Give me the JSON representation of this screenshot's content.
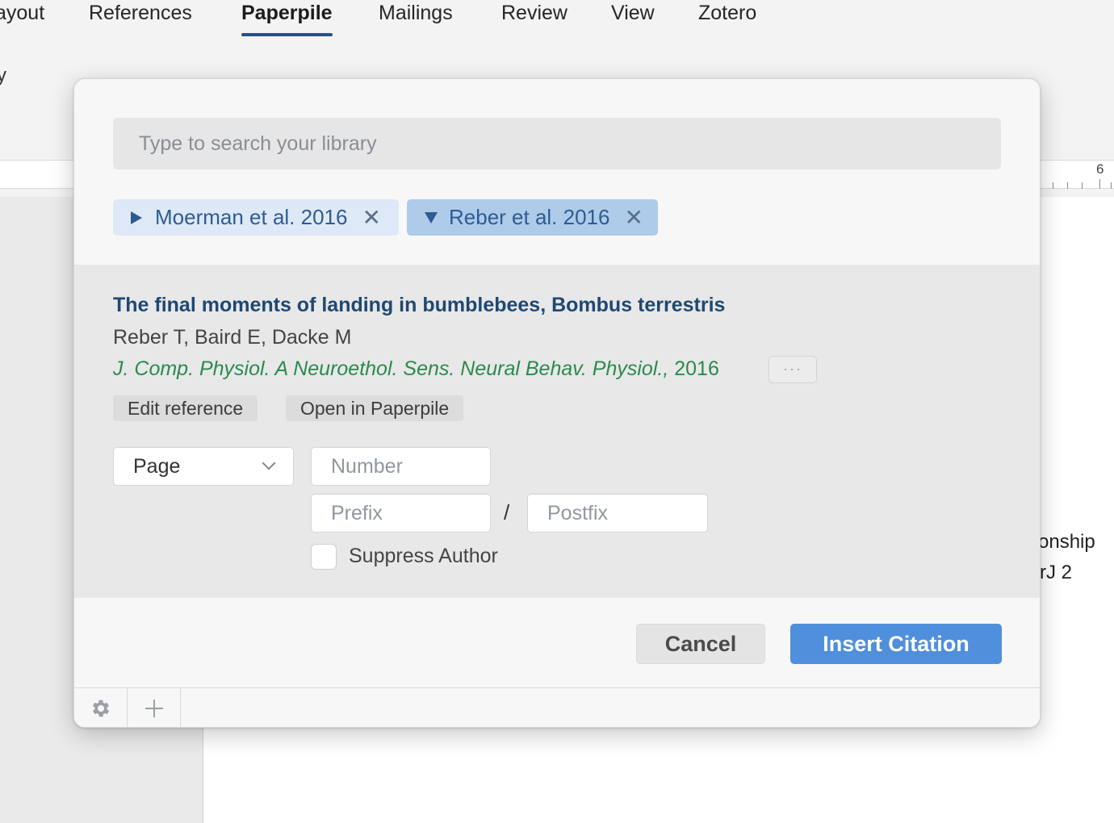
{
  "ribbon": {
    "tabs": [
      {
        "label": "ayout"
      },
      {
        "label": "References"
      },
      {
        "label": "Paperpile"
      },
      {
        "label": "Mailings"
      },
      {
        "label": "Review"
      },
      {
        "label": "View"
      },
      {
        "label": "Zotero"
      }
    ],
    "active_tab": "Paperpile",
    "fragment": "y",
    "ruler_number": "6"
  },
  "document": {
    "line_1": "onship",
    "line_2": "rJ 2"
  },
  "dialog": {
    "search": {
      "placeholder": "Type to search your library",
      "value": ""
    },
    "chips": [
      {
        "label": "Moerman et al. 2016",
        "state": "collapsed",
        "close": "✕"
      },
      {
        "label": "Reber et al. 2016",
        "state": "expanded",
        "close": "✕"
      }
    ],
    "reference": {
      "title": "The final moments of landing in bumblebees, Bombus terrestris",
      "authors": "Reber T, Baird E, Dacke M",
      "journal": "J. Comp. Physiol. A Neuroethol. Sens. Neural Behav. Physiol.,",
      "year": "2016",
      "more": "···",
      "edit_label": "Edit reference",
      "open_label": "Open in Paperpile"
    },
    "locator": {
      "type_selected": "Page",
      "number_placeholder": "Number",
      "prefix_placeholder": "Prefix",
      "separator": "/",
      "postfix_placeholder": "Postfix",
      "suppress_author_label": "Suppress Author",
      "suppress_author_checked": false
    },
    "actions": {
      "cancel_label": "Cancel",
      "insert_label": "Insert Citation"
    },
    "footer": {
      "icons": [
        "gear-icon",
        "plus-icon"
      ]
    }
  },
  "colors": {
    "accent": "#4f8fdc",
    "title_blue": "#1f4873",
    "journal_green": "#2a8a4e",
    "chip_light": "#dde9f6",
    "chip_selected": "#aecbea"
  }
}
